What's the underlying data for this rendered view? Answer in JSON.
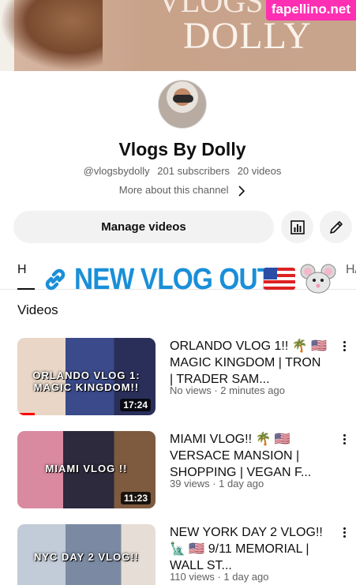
{
  "banner": {
    "text": "DOLLY",
    "partial_text": "VLOGS",
    "watermark": "fapellino.net"
  },
  "channel": {
    "name": "Vlogs By Dolly",
    "handle": "@vlogsbydolly",
    "subscribers": "201 subscribers",
    "videos_count": "20 videos",
    "more_about": "More about this channel"
  },
  "actions": {
    "manage_label": "Manage videos"
  },
  "tabs": {
    "left_fragment": "H",
    "right_fragment": "H/"
  },
  "sticker": {
    "text": "NEW VLOG OUT"
  },
  "section": {
    "title": "Videos"
  },
  "videos": [
    {
      "title": "ORLANDO VLOG 1!! 🌴 🇺🇸 MAGIC KINGDOM | TRON  | TRADER SAM...",
      "meta": "No views · 2 minutes ago",
      "duration": "17:24",
      "thumb_text": "ORLANDO VLOG 1: MAGIC KINGDOM!!",
      "progress": 0.05
    },
    {
      "title": "MIAMI VLOG!! 🌴 🇺🇸 VERSACE MANSION | SHOPPING | VEGAN F...",
      "meta": "39 views · 1 day ago",
      "duration": "11:23",
      "thumb_text": "MIAMI VLOG !!",
      "progress": 0
    },
    {
      "title": "NEW YORK DAY 2 VLOG!! 🗽 🇺🇸 9/11 MEMORIAL | WALL ST...",
      "meta": "110 views · 1 day ago",
      "duration": "",
      "thumb_text": "NYC DAY 2 VLOG!!",
      "progress": 0
    }
  ],
  "colors": {
    "accent": "#1a8fd8",
    "watermark": "#ff2fb3",
    "progress": "#ff0000"
  }
}
